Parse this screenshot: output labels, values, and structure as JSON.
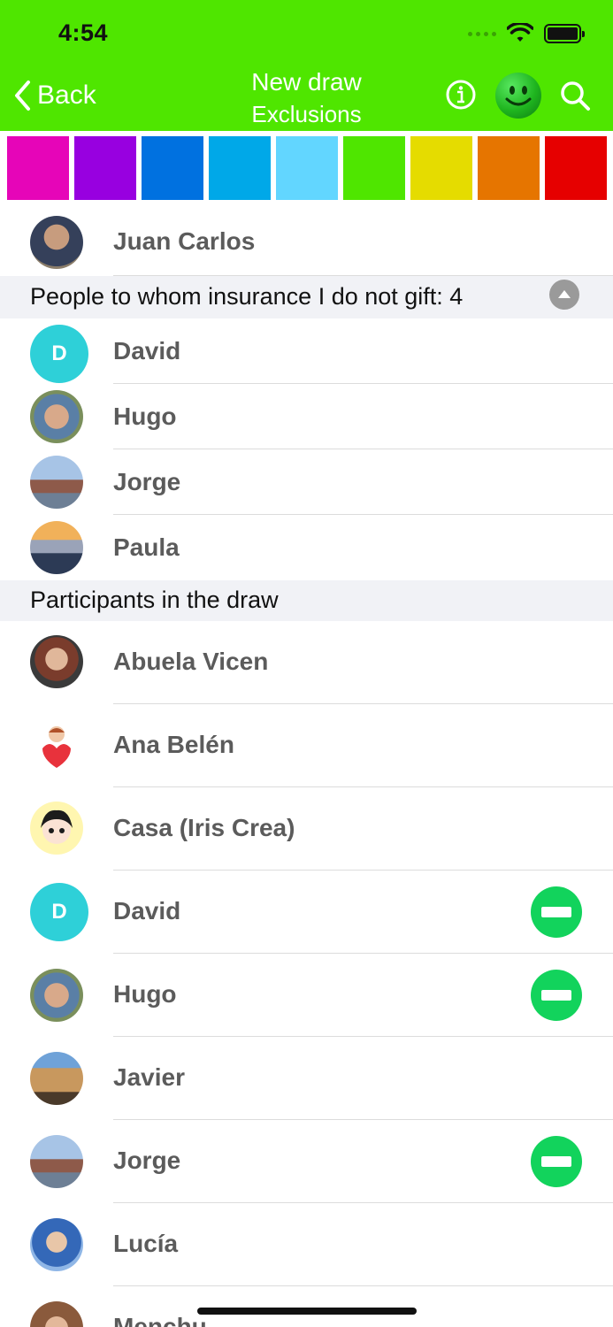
{
  "status_bar": {
    "time": "4:54"
  },
  "nav": {
    "back_label": "Back",
    "title": "New draw",
    "subtitle": "Exclusions",
    "icons": [
      "info-icon",
      "smiley-icon",
      "search-icon"
    ]
  },
  "colors": {
    "bar": "#4fe600",
    "swatches": [
      "#e605b8",
      "#9800e0",
      "#0071e0",
      "#00a8e8",
      "#62d6ff",
      "#4fe600",
      "#e5dc00",
      "#e67500",
      "#e60000"
    ],
    "minus": "#12d35c",
    "letter_avatar": "#2ed0d8"
  },
  "owner": {
    "name": "Juan Carlos",
    "avatar": "photo"
  },
  "excluded_section": {
    "label": "People to whom insurance I do not gift: 4",
    "items": [
      {
        "name": "David",
        "avatar_letter": "D"
      },
      {
        "name": "Hugo"
      },
      {
        "name": "Jorge"
      },
      {
        "name": "Paula"
      }
    ]
  },
  "participants_section": {
    "label": "Participants in the draw",
    "items": [
      {
        "name": "Abuela Vicen",
        "excluded": false
      },
      {
        "name": "Ana Belén",
        "excluded": false
      },
      {
        "name": "Casa (Iris Crea)",
        "excluded": false
      },
      {
        "name": "David",
        "avatar_letter": "D",
        "excluded": true
      },
      {
        "name": "Hugo",
        "excluded": true
      },
      {
        "name": "Javier",
        "excluded": false
      },
      {
        "name": "Jorge",
        "excluded": true
      },
      {
        "name": "Lucía",
        "excluded": false
      },
      {
        "name": "Menchu",
        "excluded": false
      }
    ]
  }
}
